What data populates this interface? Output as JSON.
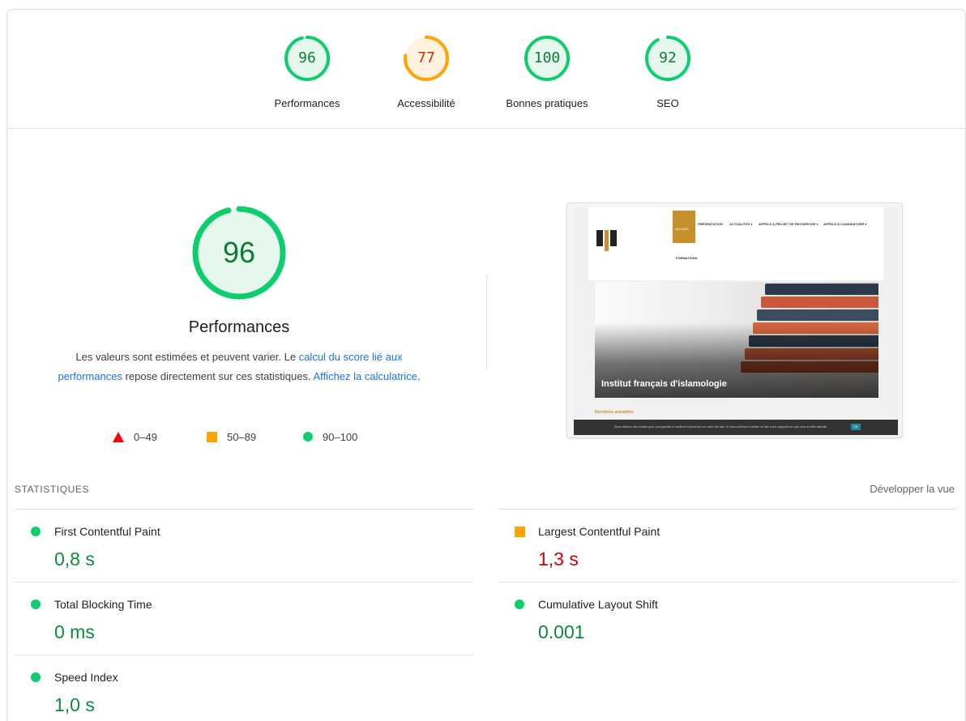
{
  "gauges": [
    {
      "label": "Performances",
      "score": "96",
      "value": 96,
      "color": "#0cce6b",
      "fill": "#e6f7ee",
      "text_color": "#0c7c34"
    },
    {
      "label": "Accessibilité",
      "score": "77",
      "value": 77,
      "color": "#ffa400",
      "fill": "#fff3e0",
      "text_color": "#c33300"
    },
    {
      "label": "Bonnes pratiques",
      "score": "100",
      "value": 100,
      "color": "#0cce6b",
      "fill": "#e6f7ee",
      "text_color": "#0c7c34"
    },
    {
      "label": "SEO",
      "score": "92",
      "value": 92,
      "color": "#0cce6b",
      "fill": "#e6f7ee",
      "text_color": "#0c7c34"
    }
  ],
  "performance": {
    "score": "96",
    "value": 96,
    "title": "Performances",
    "desc_prefix": "Les valeurs sont estimées et peuvent varier. Le ",
    "desc_link1": "calcul du score lié aux performances",
    "desc_middle": " repose directement sur ces statistiques. ",
    "desc_link2": "Affichez la calculatrice",
    "desc_suffix": "."
  },
  "legend": {
    "fail": "0–49",
    "average": "50–89",
    "pass": "90–100"
  },
  "thumbnail": {
    "nav_active": "ACCUEIL",
    "nav_items": [
      "PRÉSENTATION",
      "ACTUALITÉS ▾",
      "APPELS À PROJET DE RECHERCHE ▾",
      "APPELS À CANDIDATURE ▾"
    ],
    "nav_second": "FORMATIONS",
    "hero_title": "Institut français d'islamologie",
    "news_label": "Dernières actualités",
    "cookie_text": "Nous utilisons des cookies pour vous garantir la meilleure expérience sur notre site web. Si vous continuez à utiliser ce site, nous supposerons que vous en êtes satisfait.",
    "cookie_ok": "Ok"
  },
  "stats": {
    "title": "STATISTIQUES",
    "expand": "Développer la vue"
  },
  "metrics": [
    {
      "label": "First Contentful Paint",
      "value": "0,8 s",
      "status": "pass"
    },
    {
      "label": "Largest Contentful Paint",
      "value": "1,3 s",
      "status": "average"
    },
    {
      "label": "Total Blocking Time",
      "value": "0 ms",
      "status": "pass"
    },
    {
      "label": "Cumulative Layout Shift",
      "value": "0.001",
      "status": "pass"
    },
    {
      "label": "Speed Index",
      "value": "1,0 s",
      "status": "pass"
    }
  ]
}
